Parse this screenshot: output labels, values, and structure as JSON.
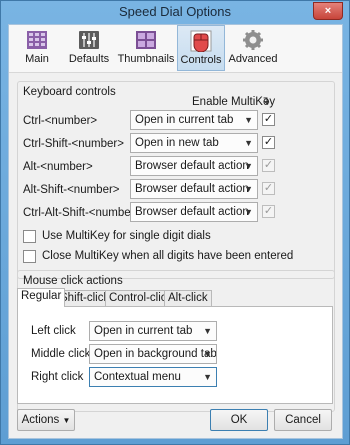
{
  "window": {
    "title": "Speed Dial Options",
    "close_glyph": "×"
  },
  "toolbar": {
    "items": [
      {
        "label": "Main",
        "icon": "grid-icon"
      },
      {
        "label": "Defaults",
        "icon": "sliders-icon"
      },
      {
        "label": "Thumbnails",
        "icon": "thumbnails-icon"
      },
      {
        "label": "Controls",
        "icon": "mouse-icon",
        "active": true
      },
      {
        "label": "Advanced",
        "icon": "gear-icon"
      }
    ]
  },
  "keyboard": {
    "title": "Keyboard controls",
    "enable_multikey": "Enable MultiKey",
    "rows": [
      {
        "label": "Ctrl-<number>",
        "value": "Open in current tab",
        "checked": true,
        "disabled": false
      },
      {
        "label": "Ctrl-Shift-<number>",
        "value": "Open in new tab",
        "checked": true,
        "disabled": false
      },
      {
        "label": "Alt-<number>",
        "value": "Browser default action",
        "checked": true,
        "disabled": true
      },
      {
        "label": "Alt-Shift-<number>",
        "value": "Browser default action",
        "checked": true,
        "disabled": true
      },
      {
        "label": "Ctrl-Alt-Shift-<number>",
        "value": "Browser default action",
        "checked": true,
        "disabled": true
      }
    ],
    "options": [
      {
        "label": "Use MultiKey for single digit dials",
        "checked": false
      },
      {
        "label": "Close MultiKey when all digits have been entered",
        "checked": false
      }
    ]
  },
  "mouse": {
    "title": "Mouse click actions",
    "tabs": [
      "Regular",
      "Shift-click",
      "Control-click",
      "Alt-click"
    ],
    "rows": [
      {
        "label": "Left click",
        "value": "Open in current tab"
      },
      {
        "label": "Middle click",
        "value": "Open in background tab"
      },
      {
        "label": "Right click",
        "value": "Contextual menu"
      }
    ]
  },
  "footer": {
    "actions": "Actions",
    "ok": "OK",
    "cancel": "Cancel"
  },
  "colors": {
    "accent": "#3c7fb1",
    "titlebar": "#6aa8d8",
    "close": "#c7443a"
  }
}
